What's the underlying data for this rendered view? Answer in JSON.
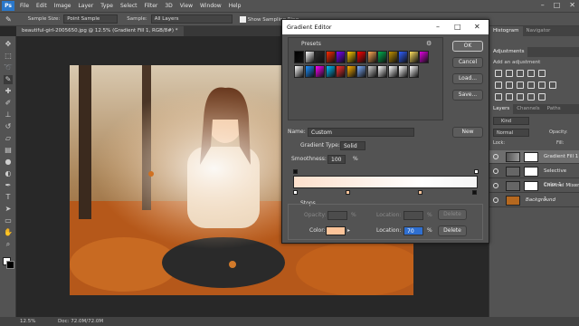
{
  "menubar": {
    "logo": "Ps",
    "items": [
      "File",
      "Edit",
      "Image",
      "Layer",
      "Type",
      "Select",
      "Filter",
      "3D",
      "View",
      "Window",
      "Help"
    ]
  },
  "options": {
    "sample_size_label": "Sample Size:",
    "sample_size_value": "Point Sample",
    "sample_label": "Sample:",
    "sample_value": "All Layers",
    "show_ring_label": "Show Sampling Ring"
  },
  "document": {
    "tab_title": "beautiful-girl-2005650.jpg @ 12.5% (Gradient Fill 1, RGB/8#) *"
  },
  "status": {
    "zoom": "12.5%",
    "doc": "Doc: 72.0M/72.0M"
  },
  "right_panel": {
    "top_tabs": [
      "Histogram",
      "Navigator"
    ],
    "adjustments_tab": "Adjustments",
    "add_adjustment": "Add an adjustment",
    "layer_tabs": [
      "Layers",
      "Channels",
      "Paths"
    ],
    "kind_label": "Kind",
    "blend_mode": "Normal",
    "opacity_label": "Opacity:",
    "lock_label": "Lock:",
    "fill_label": "Fill:",
    "layers": [
      {
        "name": "Gradient Fill 1",
        "selected": true
      },
      {
        "name": "Selective Color 1",
        "selected": false
      },
      {
        "name": "Channel Mixer 1",
        "selected": false
      },
      {
        "name": "Background",
        "selected": false
      }
    ]
  },
  "dialog": {
    "title": "Gradient Editor",
    "presets_label": "Presets",
    "buttons": {
      "ok": "OK",
      "cancel": "Cancel",
      "load": "Load...",
      "save": "Save...",
      "new": "New",
      "delete_top": "Delete",
      "delete_bottom": "Delete"
    },
    "name_label": "Name:",
    "name_value": "Custom",
    "gradient_type_label": "Gradient Type:",
    "gradient_type_value": "Solid",
    "smoothness_label": "Smoothness:",
    "smoothness_value": "100",
    "percent": "%",
    "stops_label": "Stops",
    "opacity_label": "Opacity:",
    "location_label": "Location:",
    "color_label": "Color:",
    "location_value": "70",
    "stop_color": "#fcc49a",
    "preset_colors": [
      [
        "#000000",
        "#ffffff",
        "#2a2a2a",
        "#ff2a00",
        "#7a00ff",
        "#ffcc00",
        "#ff0000",
        "#ffaa55",
        "#00b050",
        "#c09000",
        "#3060ff",
        "#ffe060",
        "#e000e0"
      ],
      [
        "#ffffff",
        "#1e90ff",
        "#ff00ff",
        "#00c0ff",
        "#ff3030",
        "#ffb000",
        "#7fb0ff",
        "#d0d0d0",
        "#ffffff",
        "#ffffff",
        "#ffffff",
        "#ffffff"
      ]
    ]
  }
}
